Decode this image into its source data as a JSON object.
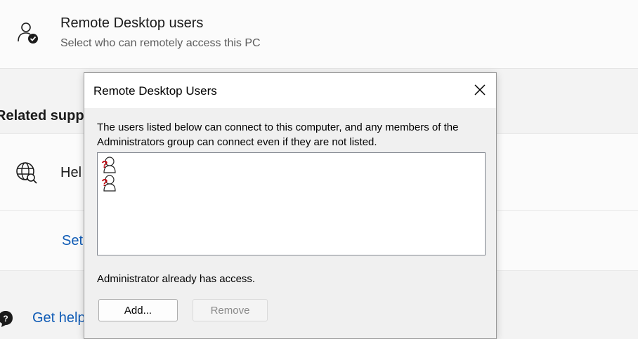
{
  "settings": {
    "remote_desktop_users": {
      "icon": "user-check-icon",
      "title": "Remote Desktop users",
      "subtitle": "Select who can remotely access this PC"
    },
    "related_support": {
      "heading": "Related supp",
      "help_item": {
        "icon": "globe-search-icon",
        "label": "Hel"
      },
      "setup_link": "Set"
    },
    "get_help": {
      "icon": "help-chat-icon",
      "label": "Get help"
    }
  },
  "dialog": {
    "title": "Remote Desktop Users",
    "close_icon": "close-icon",
    "description": "The users listed below can connect to this computer, and any members of the Administrators group can connect even if they are not listed.",
    "users": [
      {
        "icon": "unknown-user-icon",
        "label": ""
      },
      {
        "icon": "unknown-user-icon",
        "label": ""
      }
    ],
    "status": "Administrator already has access.",
    "buttons": {
      "add": "Add...",
      "remove": "Remove"
    }
  },
  "colors": {
    "link": "#0f5bb5",
    "page_background": "#f3f3f3",
    "dialog_background": "#f0f0f0",
    "disabled_text": "#8a8a8a"
  }
}
